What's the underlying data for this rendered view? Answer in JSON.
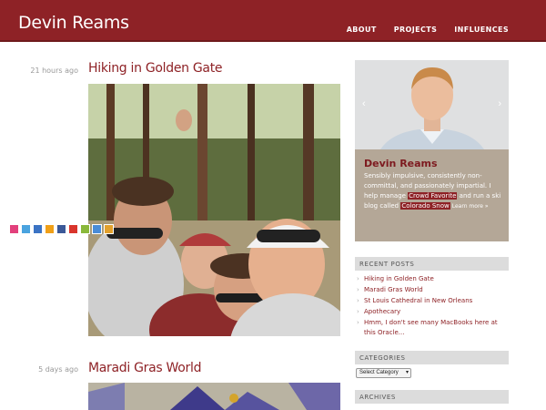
{
  "site": {
    "title": "Devin Reams"
  },
  "nav": [
    {
      "label": "ABOUT"
    },
    {
      "label": "PROJECTS"
    },
    {
      "label": "INFLUENCES"
    }
  ],
  "posts": [
    {
      "time": "21 hours ago",
      "title": "Hiking in Golden Gate"
    },
    {
      "time": "5 days ago",
      "title": "Maradi Gras World"
    }
  ],
  "profile": {
    "name": "Devin Reams",
    "bio_1": "Sensibly impulsive, consistently non-committal, and passionately impartial. I help manage ",
    "link_1": "Crowd Favorite",
    "bio_2": " and run a ski blog called ",
    "link_2": "Colorado Snow",
    "more": "Learn more »",
    "prev_arrow": "‹",
    "next_arrow": "›",
    "social_icons": [
      "flickr-icon",
      "twitter-icon",
      "delicious-icon",
      "lastfm-icon",
      "facebook-icon",
      "friendfeed-icon",
      "pownce-icon",
      "google-icon",
      "linkedin-icon"
    ]
  },
  "sidebar": {
    "recent_posts_title": "RECENT POSTS",
    "recent_posts": [
      "Hiking in Golden Gate",
      "Maradi Gras World",
      "St Louis Cathedral in New Orleans",
      "Apothecary",
      "Hmm, I don't see many MacBooks here at this Oracle..."
    ],
    "categories_title": "CATEGORIES",
    "categories_select": "Select Category",
    "archives_title": "ARCHIVES"
  }
}
